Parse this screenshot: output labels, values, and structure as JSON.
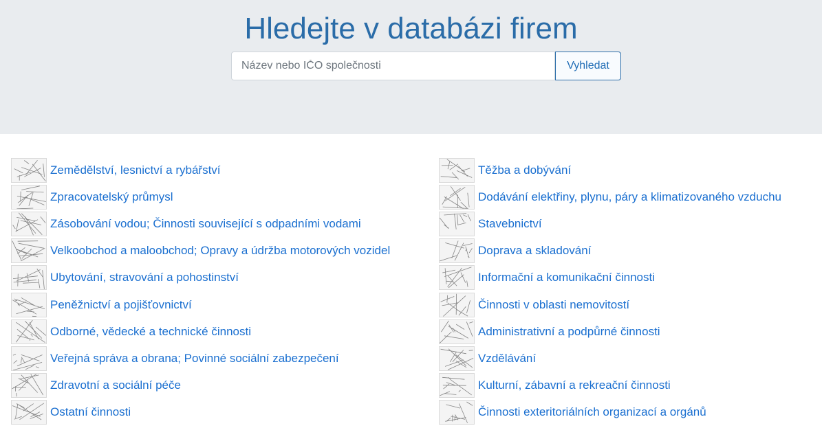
{
  "hero": {
    "title": "Hledejte v databázi firem",
    "search_placeholder": "Název nebo IČO společnosti",
    "search_value": "",
    "search_button": "Vyhledat"
  },
  "categories_left": [
    {
      "label": "Zemědělství, lesnictví a rybářství",
      "icon": "tractor-icon"
    },
    {
      "label": "Zpracovatelský průmysl",
      "icon": "gears-icon"
    },
    {
      "label": "Zásobování vodou; Činnosti související s odpadními vodami",
      "icon": "water-pipe-icon"
    },
    {
      "label": "Velkoobchod a maloobchod; Opravy a údržba motorových vozidel",
      "icon": "shop-icon"
    },
    {
      "label": "Ubytování, stravování a pohostinství",
      "icon": "restaurant-icon"
    },
    {
      "label": "Peněžnictví a pojišťovnictví",
      "icon": "coins-icon"
    },
    {
      "label": "Odborné, vědecké a technické činnosti",
      "icon": "graph-icon"
    },
    {
      "label": "Veřejná správa a obrana; Povinné sociální zabezpečení",
      "icon": "parliament-icon"
    },
    {
      "label": "Zdravotní a sociální péče",
      "icon": "medical-star-icon"
    },
    {
      "label": "Ostatní činnosti",
      "icon": "fleur-de-lis-icon"
    }
  ],
  "categories_right": [
    {
      "label": "Těžba a dobývání",
      "icon": "mining-icon"
    },
    {
      "label": "Dodávání elektřiny, plynu, páry a klimatizovaného vzduchu",
      "icon": "power-pylon-icon"
    },
    {
      "label": "Stavebnictví",
      "icon": "construction-icon"
    },
    {
      "label": "Doprava a skladování",
      "icon": "truck-icon"
    },
    {
      "label": "Informační a komunikační činnosti",
      "icon": "server-icon"
    },
    {
      "label": "Činnosti v oblasti nemovitostí",
      "icon": "house-icon"
    },
    {
      "label": "Administrativní a podpůrné činnosti",
      "icon": "office-icon"
    },
    {
      "label": "Vzdělávání",
      "icon": "graduation-icon"
    },
    {
      "label": "Kulturní, zábavní a rekreační činnosti",
      "icon": "theatre-icon"
    },
    {
      "label": "Činnosti exteritoriálních organizací a orgánů",
      "icon": "world-map-icon"
    }
  ]
}
